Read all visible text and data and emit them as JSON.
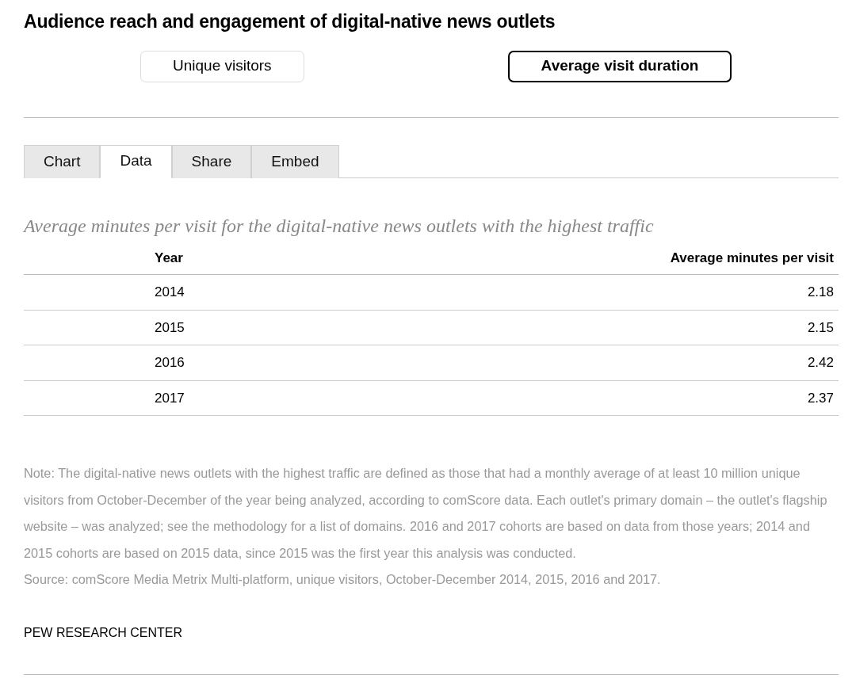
{
  "title": "Audience reach and engagement of digital-native news outlets",
  "toggles": [
    {
      "label": "Unique visitors",
      "selected": false
    },
    {
      "label": "Average visit duration",
      "selected": true
    }
  ],
  "tabs": [
    {
      "label": "Chart",
      "selected": false
    },
    {
      "label": "Data",
      "selected": true
    },
    {
      "label": "Share",
      "selected": false
    },
    {
      "label": "Embed",
      "selected": false
    }
  ],
  "table": {
    "caption": "Average minutes per visit for the digital-native news outlets with the highest traffic",
    "columns": [
      "Year",
      "Average minutes per visit"
    ],
    "rows": [
      [
        "2014",
        "2.18"
      ],
      [
        "2015",
        "2.15"
      ],
      [
        "2016",
        "2.42"
      ],
      [
        "2017",
        "2.37"
      ]
    ]
  },
  "note": "Note: The digital-native news outlets with the highest traffic are defined as those that had a monthly average of at least 10 million unique visitors from October-December of the year being analyzed, according to comScore data. Each outlet's primary domain – the outlet's flagship website – was analyzed; see the methodology for a list of domains. 2016 and 2017 cohorts are based on data from those years; 2014 and 2015 cohorts are based on 2015 data, since 2015 was the first year this analysis was conducted.",
  "source": "Source: comScore Media Metrix Multi-platform, unique visitors, October-December 2014, 2015, 2016 and 2017.",
  "footer": "PEW RESEARCH CENTER"
}
